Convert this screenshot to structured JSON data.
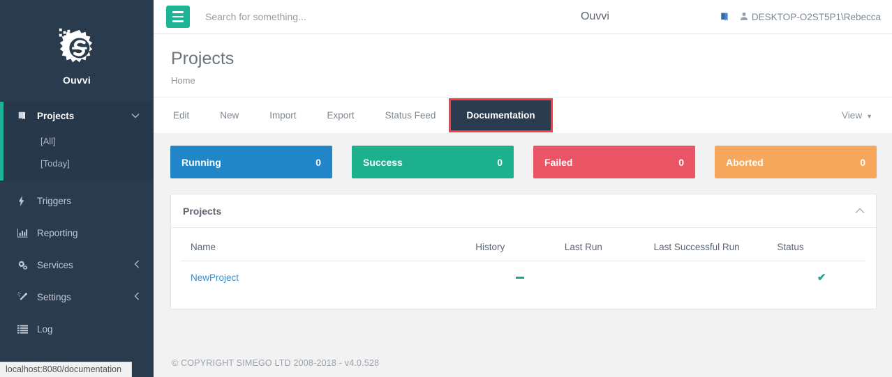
{
  "brand": {
    "name": "Ouvvi",
    "logo_icon": "gear-s-logo"
  },
  "sidebar": {
    "projects": {
      "label": "Projects",
      "icon": "book-icon",
      "caret": "chevron-down-icon",
      "children": [
        {
          "label": "[All]"
        },
        {
          "label": "[Today]"
        }
      ]
    },
    "items": [
      {
        "label": "Triggers",
        "icon": "bolt-icon",
        "caret": ""
      },
      {
        "label": "Reporting",
        "icon": "bar-chart-icon",
        "caret": ""
      },
      {
        "label": "Services",
        "icon": "gears-icon",
        "caret": "chevron-left-icon"
      },
      {
        "label": "Settings",
        "icon": "magic-wand-icon",
        "caret": "chevron-left-icon"
      },
      {
        "label": "Log",
        "icon": "list-icon",
        "caret": ""
      }
    ]
  },
  "topbar": {
    "menu_icon": "hamburger-icon",
    "search_placeholder": "Search for something...",
    "search_value": "",
    "title": "Ouvvi",
    "docs_icon": "book-icon",
    "user_icon": "user-icon",
    "user_label": "DESKTOP-O2ST5P1\\Rebecca"
  },
  "page": {
    "title": "Projects",
    "breadcrumb": "Home"
  },
  "tabs": [
    {
      "label": "Edit",
      "active": false
    },
    {
      "label": "New",
      "active": false
    },
    {
      "label": "Import",
      "active": false
    },
    {
      "label": "Export",
      "active": false
    },
    {
      "label": "Status Feed",
      "active": false
    },
    {
      "label": "Documentation",
      "active": true
    }
  ],
  "tab_right": {
    "label": "View",
    "caret": "caret-down-icon"
  },
  "tiles": [
    {
      "label": "Running",
      "count": "0",
      "color": "#2086c8"
    },
    {
      "label": "Success",
      "count": "0",
      "color": "#1cb08c"
    },
    {
      "label": "Failed",
      "count": "0",
      "color": "#ea5566"
    },
    {
      "label": "Aborted",
      "count": "0",
      "color": "#f6a75c"
    }
  ],
  "panel": {
    "title": "Projects",
    "collapse_icon": "chevron-up-icon",
    "columns": [
      "Name",
      "History",
      "Last Run",
      "Last Successful Run",
      "Status"
    ],
    "rows": [
      {
        "name": "NewProject",
        "history": "-",
        "last_run": "",
        "last_successful_run": "",
        "status_icon": "check-icon"
      }
    ]
  },
  "footer": {
    "text": "© COPYRIGHT SIMEGO LTD 2008-2018 - v4.0.528"
  },
  "statusbar": {
    "url": "localhost:8080/documentation"
  },
  "highlight": {
    "color": "#fb3b40",
    "target": "Documentation"
  }
}
